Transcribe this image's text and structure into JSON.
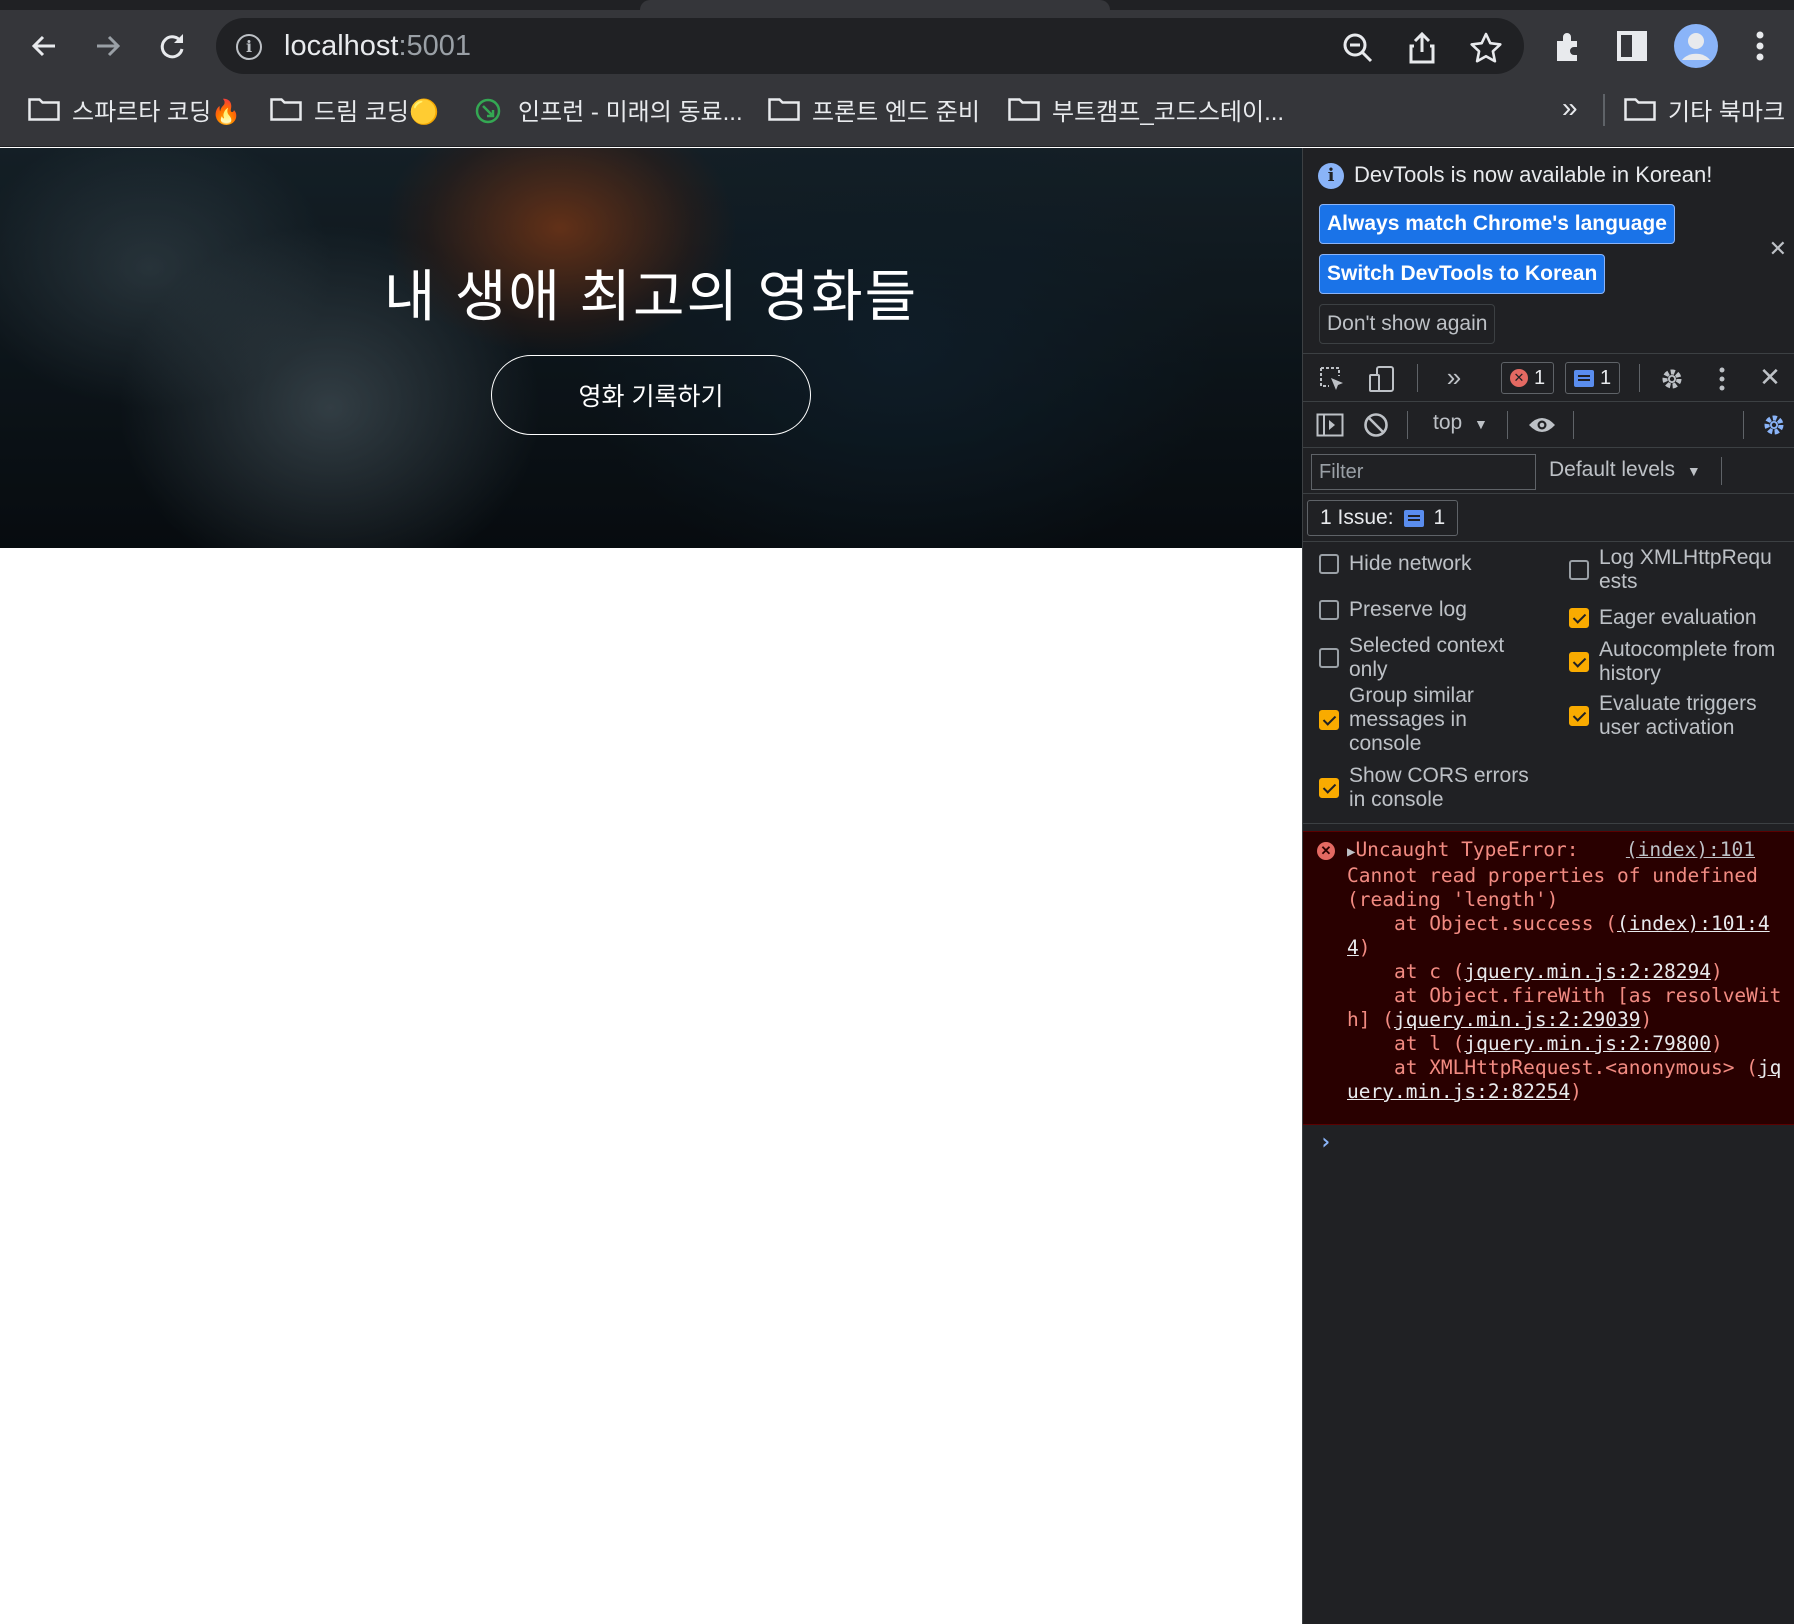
{
  "browser": {
    "url_host": "localhost",
    "url_port": ":5001",
    "bookmarks": [
      {
        "label": "스파르타 코딩🔥",
        "icon": "folder-icon"
      },
      {
        "label": "드림 코딩🟡",
        "icon": "folder-icon"
      },
      {
        "label": "인프런 - 미래의 동료...",
        "icon": "inflearn-icon"
      },
      {
        "label": "프론트 엔드 준비",
        "icon": "folder-icon"
      },
      {
        "label": "부트캠프_코드스테이...",
        "icon": "folder-icon"
      }
    ],
    "more_bookmarks": "»",
    "other_bookmarks": "기타 북마크"
  },
  "page": {
    "hero_title": "내 생애 최고의 영화들",
    "hero_button": "영화 기록하기"
  },
  "devtools": {
    "infobar": {
      "message": "DevTools is now available in Korean!",
      "btn_match": "Always match Chrome's language",
      "btn_switch": "Switch DevTools to Korean",
      "btn_dont_show": "Don't show again"
    },
    "error_count": "1",
    "message_count": "1",
    "context": "top",
    "filter_placeholder": "Filter",
    "levels": "Default levels",
    "issues_label": "1 Issue:",
    "issues_count": "1",
    "settings_left": [
      {
        "label": "Hide network",
        "checked": false
      },
      {
        "label": "Preserve log",
        "checked": false
      },
      {
        "label": "Selected context only",
        "checked": false
      },
      {
        "label": "Group similar messages in console",
        "checked": true
      },
      {
        "label": "Show CORS errors in console",
        "checked": true
      }
    ],
    "settings_right": [
      {
        "label": "Log XMLHttpRequests",
        "checked": false
      },
      {
        "label": "Eager evaluation",
        "checked": true
      },
      {
        "label": "Autocomplete from history",
        "checked": true
      },
      {
        "label": "Evaluate triggers user activation",
        "checked": true
      }
    ],
    "error": {
      "source": "(index):101",
      "line1": "Uncaught TypeError:",
      "line2": "Cannot read properties of undefined (reading 'length')",
      "stack": [
        {
          "prefix": "    at Object.success (",
          "link": "(index):101:44",
          "suffix": ")"
        },
        {
          "prefix": "    at c (",
          "link": "jquery.min.js:2:28294",
          "suffix": ")"
        },
        {
          "prefix": "    at Object.fireWith [as resolveWith] (",
          "link": "jquery.min.js:2:29039",
          "suffix": ")"
        },
        {
          "prefix": "    at l (",
          "link": "jquery.min.js:2:79800",
          "suffix": ")"
        },
        {
          "prefix": "    at XMLHttpRequest.<anonymous> (",
          "link": "jquery.min.js:2:82254",
          "suffix": ")"
        }
      ]
    },
    "prompt": "›"
  },
  "colors": {
    "chrome_bg": "#35363a",
    "omnibox_bg": "#202124",
    "devtools_bg": "#202124",
    "primary_button": "#1a73e8",
    "checkbox_on": "#f9ab00",
    "error_bg": "#290000",
    "error_text": "#f28b82"
  }
}
